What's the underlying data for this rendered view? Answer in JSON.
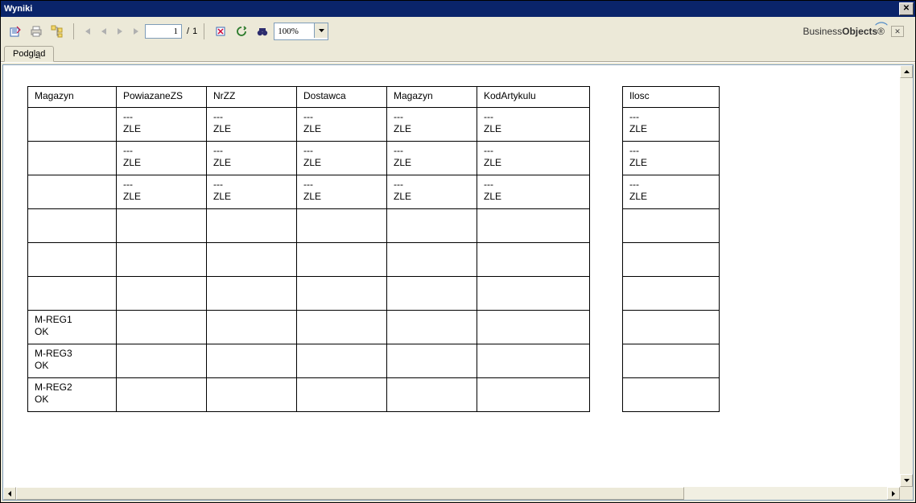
{
  "window": {
    "title": "Wyniki"
  },
  "toolbar": {
    "page_current": "1",
    "page_total": "1",
    "zoom": "100%"
  },
  "tabs": {
    "preview_label": "Podgląd",
    "preview_hotkey_char": "a"
  },
  "brand": {
    "text1": "Business",
    "text2": "Objects"
  },
  "table1": {
    "headers": [
      "Magazyn",
      "PowiazaneZS",
      "NrZZ",
      "Dostawca",
      "Magazyn",
      "KodArtykulu"
    ],
    "rows": [
      [
        "",
        "---\nZLE",
        "---\nZLE",
        "---\nZLE",
        "---\nZLE",
        "---\nZLE"
      ],
      [
        "",
        "---\nZLE",
        "---\nZLE",
        "---\nZLE",
        "---\nZLE",
        "---\nZLE"
      ],
      [
        "",
        "---\nZLE",
        "---\nZLE",
        "---\nZLE",
        "---\nZLE",
        "---\nZLE"
      ],
      [
        "",
        "",
        "",
        "",
        "",
        ""
      ],
      [
        "",
        "",
        "",
        "",
        "",
        ""
      ],
      [
        "",
        "",
        "",
        "",
        "",
        ""
      ],
      [
        "M-REG1\nOK",
        "",
        "",
        "",
        "",
        ""
      ],
      [
        "M-REG3\nOK",
        "",
        "",
        "",
        "",
        ""
      ],
      [
        "M-REG2\nOK",
        "",
        "",
        "",
        "",
        ""
      ]
    ]
  },
  "table2": {
    "headers": [
      "Ilosc"
    ],
    "rows": [
      [
        "---\nZLE"
      ],
      [
        "---\nZLE"
      ],
      [
        "---\nZLE"
      ],
      [
        ""
      ],
      [
        ""
      ],
      [
        ""
      ],
      [
        ""
      ],
      [
        ""
      ],
      [
        ""
      ]
    ]
  }
}
